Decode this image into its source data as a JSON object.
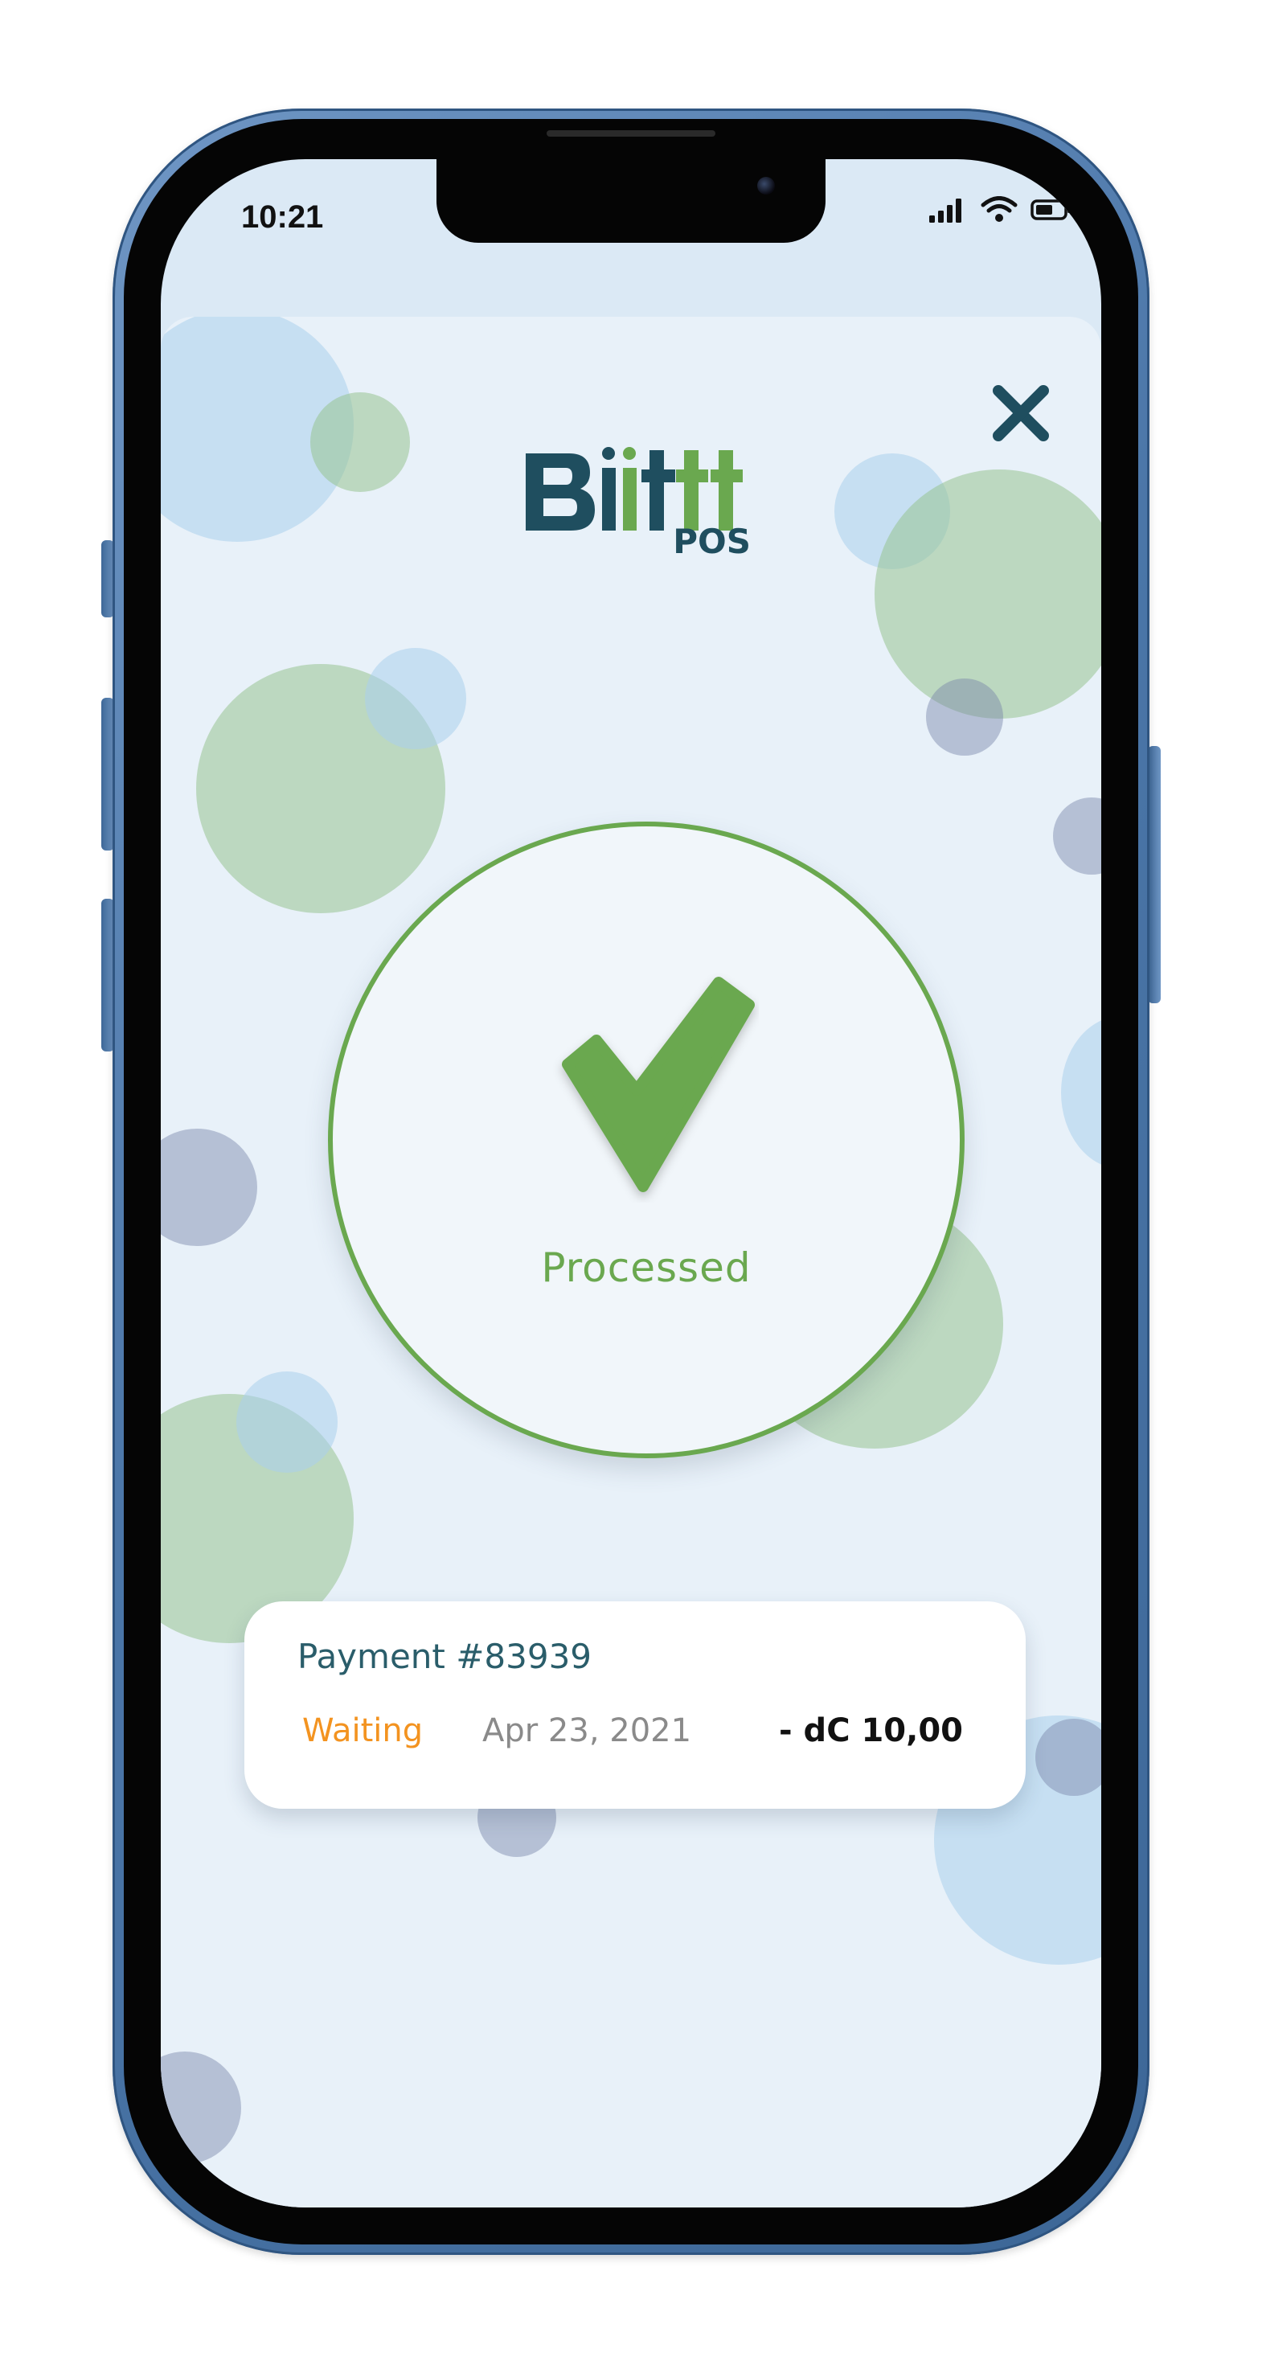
{
  "status_bar": {
    "time": "10:21",
    "icons": [
      "cellular-signal-icon",
      "wifi-icon",
      "battery-icon"
    ]
  },
  "header": {
    "close_icon": "close-icon",
    "logo": {
      "brand": "Biittt",
      "subtitle": "POS",
      "colors": {
        "dark": "#1f4e5f",
        "green": "#6aa84f"
      }
    }
  },
  "result": {
    "icon": "checkmark-icon",
    "label": "Processed",
    "color": "#6aa84f"
  },
  "payment": {
    "title": "Payment #83939",
    "status": "Waiting",
    "date": "Apr 23, 2021",
    "amount": "- dC 10,00",
    "colors": {
      "title": "#2a5d6a",
      "status": "#f39320",
      "date": "#8a8a8a"
    }
  },
  "theme": {
    "background": "#e8f1f9",
    "bubble_blue": "#a9d0ec",
    "bubble_green": "#97c391",
    "bubble_slate": "#7886a8",
    "phone_frame": "#4b76a8"
  }
}
